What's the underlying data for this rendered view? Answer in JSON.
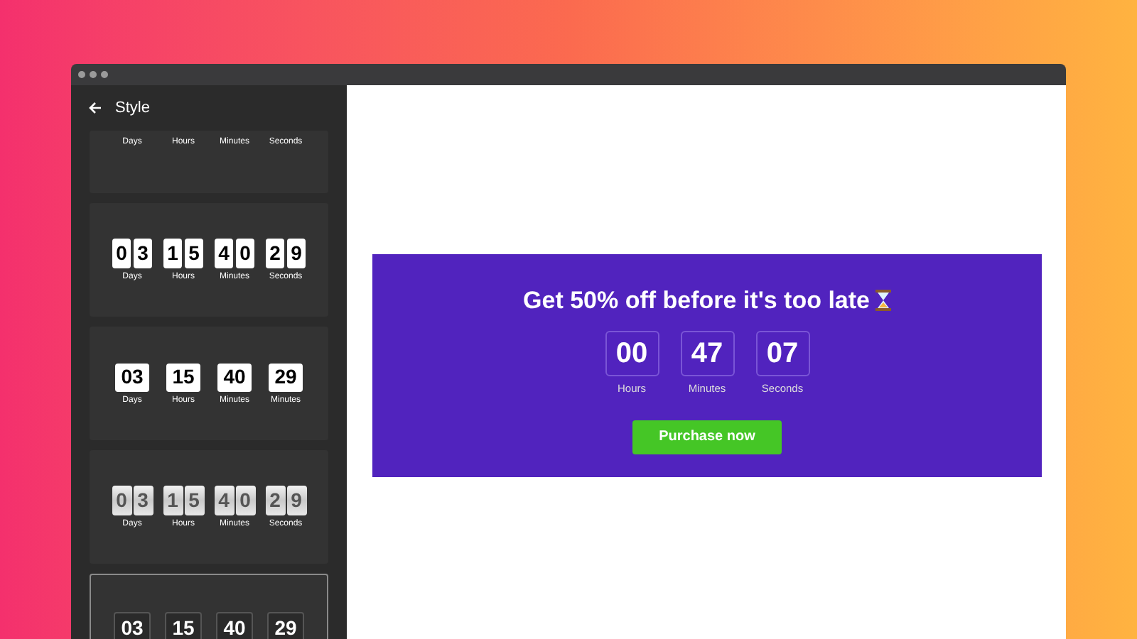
{
  "sidebar": {
    "title": "Style"
  },
  "styles": [
    {
      "kind": "plain",
      "selected": false,
      "units": [
        {
          "label": "Days"
        },
        {
          "label": "Hours"
        },
        {
          "label": "Minutes"
        },
        {
          "label": "Seconds"
        }
      ]
    },
    {
      "kind": "split-tile",
      "selected": false,
      "units": [
        {
          "tiles": [
            "0",
            "3"
          ],
          "label": "Days"
        },
        {
          "tiles": [
            "1",
            "5"
          ],
          "label": "Hours"
        },
        {
          "tiles": [
            "4",
            "0"
          ],
          "label": "Minutes"
        },
        {
          "tiles": [
            "2",
            "9"
          ],
          "label": "Seconds"
        }
      ]
    },
    {
      "kind": "tile",
      "selected": false,
      "units": [
        {
          "digits": "03",
          "label": "Days"
        },
        {
          "digits": "15",
          "label": "Hours"
        },
        {
          "digits": "40",
          "label": "Minutes"
        },
        {
          "digits": "29",
          "label": "Minutes"
        }
      ]
    },
    {
      "kind": "flip",
      "selected": false,
      "units": [
        {
          "tiles": [
            "0",
            "3"
          ],
          "label": "Days"
        },
        {
          "tiles": [
            "1",
            "5"
          ],
          "label": "Hours"
        },
        {
          "tiles": [
            "4",
            "0"
          ],
          "label": "Minutes"
        },
        {
          "tiles": [
            "2",
            "9"
          ],
          "label": "Seconds"
        }
      ]
    },
    {
      "kind": "outline",
      "selected": true,
      "units": [
        {
          "digits": "03"
        },
        {
          "digits": "15"
        },
        {
          "digits": "40"
        },
        {
          "digits": "29"
        }
      ]
    }
  ],
  "banner": {
    "headline": "Get 50% off before it's too late",
    "units": [
      {
        "value": "00",
        "label": "Hours"
      },
      {
        "value": "47",
        "label": "Minutes"
      },
      {
        "value": "07",
        "label": "Seconds"
      }
    ],
    "button": "Purchase now"
  }
}
